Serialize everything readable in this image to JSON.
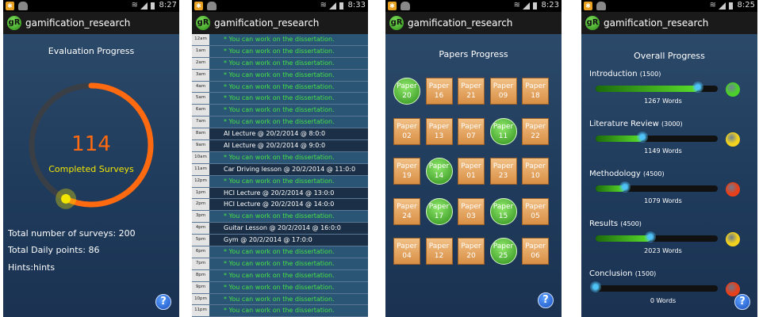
{
  "app_title": "gamification_research",
  "app_icon_text": "gR",
  "help_label": "?",
  "screens": {
    "evaluation": {
      "clock": "8:27",
      "title": "Evaluation Progress",
      "count": "114",
      "count_label": "Completed Surveys",
      "progress_fraction": 0.57,
      "colors": {
        "progress": "#ff6a10",
        "remaining": "#3a3f46",
        "knob": "#f2e600"
      },
      "stats": [
        "Total number of surveys: 200",
        "Total Daily points: 86",
        "Hints:hints"
      ]
    },
    "schedule": {
      "clock": "8:33",
      "rows": [
        {
          "hour": "12am",
          "text": "* You can work on the dissertation.",
          "kind": "free"
        },
        {
          "hour": "1am",
          "text": "* You can work on the dissertation.",
          "kind": "free"
        },
        {
          "hour": "2am",
          "text": "* You can work on the dissertation.",
          "kind": "free"
        },
        {
          "hour": "3am",
          "text": "* You can work on the dissertation.",
          "kind": "free"
        },
        {
          "hour": "4am",
          "text": "* You can work on the dissertation.",
          "kind": "free"
        },
        {
          "hour": "5am",
          "text": "* You can work on the dissertation.",
          "kind": "free"
        },
        {
          "hour": "6am",
          "text": "* You can work on the dissertation.",
          "kind": "free"
        },
        {
          "hour": "7am",
          "text": "* You can work on the dissertation.",
          "kind": "free"
        },
        {
          "hour": "8am",
          "text": "AI Lecture @ 20/2/2014 @ 8:0:0",
          "kind": "busy"
        },
        {
          "hour": "9am",
          "text": "AI Lecture @ 20/2/2014 @ 9:0:0",
          "kind": "busy"
        },
        {
          "hour": "10am",
          "text": "* You can work on the dissertation.",
          "kind": "free"
        },
        {
          "hour": "11am",
          "text": "Car Driving lesson @ 20/2/2014 @ 11:0:0",
          "kind": "busy"
        },
        {
          "hour": "12pm",
          "text": "* You can work on the dissertation.",
          "kind": "free"
        },
        {
          "hour": "1pm",
          "text": "HCI Lecture @ 20/2/2014 @ 13:0:0",
          "kind": "busy"
        },
        {
          "hour": "2pm",
          "text": "HCI Lecture @ 20/2/2014 @ 14:0:0",
          "kind": "busy"
        },
        {
          "hour": "3pm",
          "text": "* You can work on the dissertation.",
          "kind": "free"
        },
        {
          "hour": "4pm",
          "text": "Guitar Lesson @ 20/2/2014 @ 16:0:0",
          "kind": "busy"
        },
        {
          "hour": "5pm",
          "text": "Gym @ 20/2/2014 @ 17:0:0",
          "kind": "busy"
        },
        {
          "hour": "6pm",
          "text": "* You can work on the dissertation.",
          "kind": "free"
        },
        {
          "hour": "7pm",
          "text": "* You can work on the dissertation.",
          "kind": "free"
        },
        {
          "hour": "8pm",
          "text": "* You can work on the dissertation.",
          "kind": "free"
        },
        {
          "hour": "9pm",
          "text": "* You can work on the dissertation.",
          "kind": "free"
        },
        {
          "hour": "10pm",
          "text": "* You can work on the dissertation.",
          "kind": "free"
        },
        {
          "hour": "11pm",
          "text": "* You can work on the dissertation.",
          "kind": "free"
        },
        {
          "hour": "12pm",
          "text": "* You can work on the dissertation.",
          "kind": "free"
        }
      ]
    },
    "papers": {
      "clock": "8:23",
      "title": "Papers Progress",
      "papers": [
        {
          "line1": "Paper",
          "line2": "20",
          "done": true
        },
        {
          "line1": "Paper",
          "line2": "16",
          "done": false
        },
        {
          "line1": "Paper",
          "line2": "21",
          "done": false
        },
        {
          "line1": "Paper",
          "line2": "09",
          "done": false
        },
        {
          "line1": "Paper",
          "line2": "18",
          "done": false
        },
        {
          "line1": "Paper",
          "line2": "02",
          "done": false
        },
        {
          "line1": "Paper",
          "line2": "13",
          "done": false
        },
        {
          "line1": "Paper",
          "line2": "07",
          "done": false
        },
        {
          "line1": "Paper",
          "line2": "11",
          "done": true
        },
        {
          "line1": "Paper",
          "line2": "22",
          "done": false
        },
        {
          "line1": "Paper",
          "line2": "19",
          "done": false
        },
        {
          "line1": "Paper",
          "line2": "14",
          "done": true
        },
        {
          "line1": "Paper",
          "line2": "01",
          "done": false
        },
        {
          "line1": "Paper",
          "line2": "23",
          "done": false
        },
        {
          "line1": "Paper",
          "line2": "10",
          "done": false
        },
        {
          "line1": "Paper",
          "line2": "24",
          "done": false
        },
        {
          "line1": "Paper",
          "line2": "17",
          "done": true
        },
        {
          "line1": "Paper",
          "line2": "03",
          "done": false
        },
        {
          "line1": "Paper",
          "line2": "15",
          "done": true
        },
        {
          "line1": "Paper",
          "line2": "05",
          "done": false
        },
        {
          "line1": "Paper",
          "line2": "04",
          "done": false
        },
        {
          "line1": "Paper",
          "line2": "12",
          "done": false
        },
        {
          "line1": "Paper",
          "line2": "20",
          "done": false
        },
        {
          "line1": "Paper",
          "line2": "25",
          "done": true
        },
        {
          "line1": "Paper",
          "line2": "06",
          "done": false
        }
      ]
    },
    "overall": {
      "clock": "8:25",
      "title": "Overall Progress",
      "sections": [
        {
          "name": "Introduction",
          "target": "(1500)",
          "words": "1267 Words",
          "progress": 0.84,
          "status_color": "#4cd02a"
        },
        {
          "name": "Literature Review",
          "target": "(3000)",
          "words": "1149 Words",
          "progress": 0.38,
          "status_color": "#f2d21e"
        },
        {
          "name": "Methodology",
          "target": "(4500)",
          "words": "1079 Words",
          "progress": 0.24,
          "status_color": "#e8401a"
        },
        {
          "name": "Results",
          "target": "(4500)",
          "words": "2023 Words",
          "progress": 0.45,
          "status_color": "#f2d21e"
        },
        {
          "name": "Conclusion",
          "target": "(1500)",
          "words": "0 Words",
          "progress": 0.0,
          "status_color": "#e8401a"
        }
      ]
    }
  }
}
